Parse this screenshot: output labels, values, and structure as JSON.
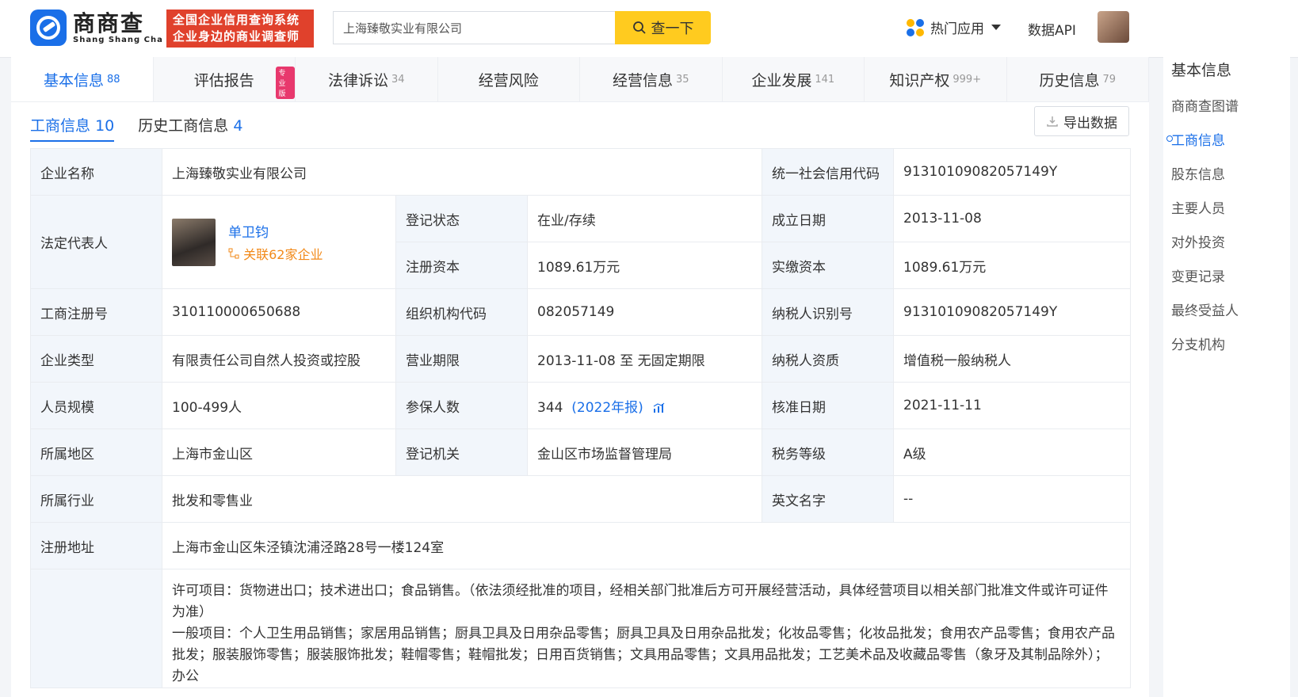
{
  "header": {
    "logo_cn": "商商查",
    "logo_en": "Shang Shang Cha",
    "slogan_line1": "全国企业信用查询系统",
    "slogan_line2": "企业身边的商业调查师",
    "search_value": "上海臻敬实业有限公司",
    "search_button": "查一下",
    "hot_apps": "热门应用",
    "data_api": "数据API"
  },
  "tabs": [
    {
      "label": "基本信息",
      "count": "88"
    },
    {
      "label": "评估报告",
      "count": "",
      "badge": "专业版"
    },
    {
      "label": "法律诉讼",
      "count": "34"
    },
    {
      "label": "经营风险",
      "count": ""
    },
    {
      "label": "经营信息",
      "count": "35"
    },
    {
      "label": "企业发展",
      "count": "141"
    },
    {
      "label": "知识产权",
      "count": "999+"
    },
    {
      "label": "历史信息",
      "count": "79"
    }
  ],
  "subtabs": [
    {
      "label": "工商信息",
      "count": "10"
    },
    {
      "label": "历史工商信息",
      "count": "4"
    }
  ],
  "export_label": "导出数据",
  "info": {
    "company_name_label": "企业名称",
    "company_name": "上海臻敬实业有限公司",
    "credit_code_label": "统一社会信用代码",
    "credit_code": "91310109082057149Y",
    "legal_rep_label": "法定代表人",
    "legal_rep_name": "单卫钧",
    "legal_rep_related": "关联62家企业",
    "reg_status_label": "登记状态",
    "reg_status": "在业/存续",
    "found_date_label": "成立日期",
    "found_date": "2013-11-08",
    "reg_capital_label": "注册资本",
    "reg_capital": "1089.61万元",
    "paid_capital_label": "实缴资本",
    "paid_capital": "1089.61万元",
    "reg_no_label": "工商注册号",
    "reg_no": "310110000650688",
    "org_code_label": "组织机构代码",
    "org_code": "082057149",
    "taxpayer_id_label": "纳税人识别号",
    "taxpayer_id": "91310109082057149Y",
    "type_label": "企业类型",
    "type": "有限责任公司自然人投资或控股",
    "term_label": "营业期限",
    "term": "2013-11-08 至 无固定期限",
    "taxpayer_qual_label": "纳税人资质",
    "taxpayer_qual": "增值税一般纳税人",
    "staff_label": "人员规模",
    "staff": "100-499人",
    "insured_label": "参保人数",
    "insured": "344",
    "insured_year": "(2022年报)",
    "approve_label": "核准日期",
    "approve": "2021-11-11",
    "region_label": "所属地区",
    "region": "上海市金山区",
    "authority_label": "登记机关",
    "authority": "金山区市场监督管理局",
    "tax_grade_label": "税务等级",
    "tax_grade": "A级",
    "industry_label": "所属行业",
    "industry": "批发和零售业",
    "english_label": "英文名字",
    "english": "--",
    "address_label": "注册地址",
    "address": "上海市金山区朱泾镇沈浦泾路28号一楼124室",
    "scope_line1": "许可项目：货物进出口；技术进出口；食品销售。（依法须经批准的项目，经相关部门批准后方可开展经营活动，具体经营项目以相关部门批准文件或许可证件为准）",
    "scope_line2": "一般项目：个人卫生用品销售；家居用品销售；厨具卫具及日用杂品零售；厨具卫具及日用杂品批发；化妆品零售；化妆品批发；食用农产品零售；食用农产品批发；服装服饰零售；服装服饰批发；鞋帽零售；鞋帽批发；日用百货销售；文具用品零售；文具用品批发；工艺美术品及收藏品零售（象牙及其制品除外）；办公"
  },
  "sidebar": {
    "title": "基本信息",
    "items": [
      "商商查图谱",
      "工商信息",
      "股东信息",
      "主要人员",
      "对外投资",
      "变更记录",
      "最终受益人",
      "分支机构"
    ]
  }
}
